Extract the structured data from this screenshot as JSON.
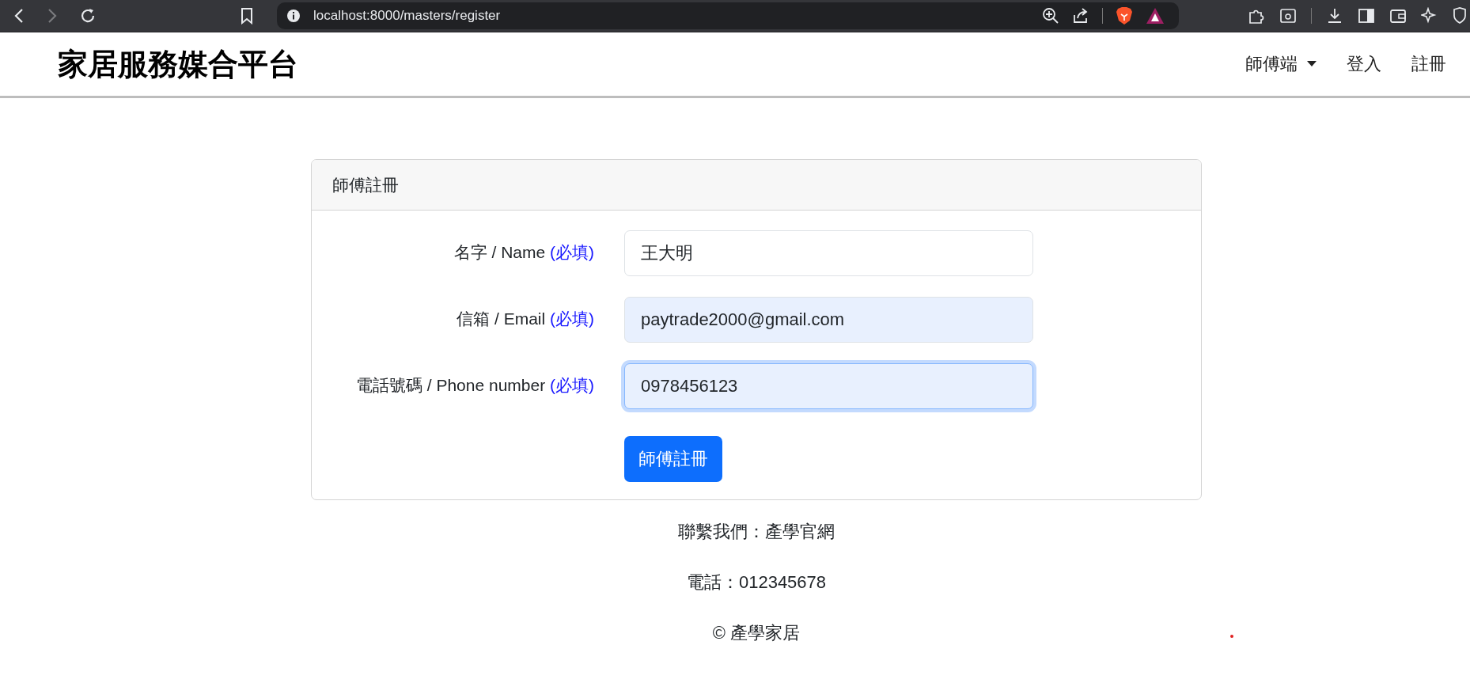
{
  "browser": {
    "url": "localhost:8000/masters/register"
  },
  "navbar": {
    "brand": "家居服務媒合平台",
    "items": [
      {
        "label": "師傅端",
        "kind": "dropdown"
      },
      {
        "label": "登入",
        "kind": "link"
      },
      {
        "label": "註冊",
        "kind": "link"
      }
    ]
  },
  "card": {
    "title": "師傅註冊",
    "fields": [
      {
        "label": "名字 / Name",
        "required": "(必填)",
        "value": "王大明",
        "autofilled": false,
        "focused": false
      },
      {
        "label": "信箱 / Email",
        "required": "(必填)",
        "value": "paytrade2000@gmail.com",
        "autofilled": true,
        "focused": false
      },
      {
        "label": "電話號碼 / Phone number",
        "required": "(必填)",
        "value": "0978456123",
        "autofilled": true,
        "focused": true
      }
    ],
    "submit": "師傅註冊"
  },
  "footer": [
    "聯繫我們：產學官網",
    "電話：012345678",
    "© 產學家居"
  ]
}
